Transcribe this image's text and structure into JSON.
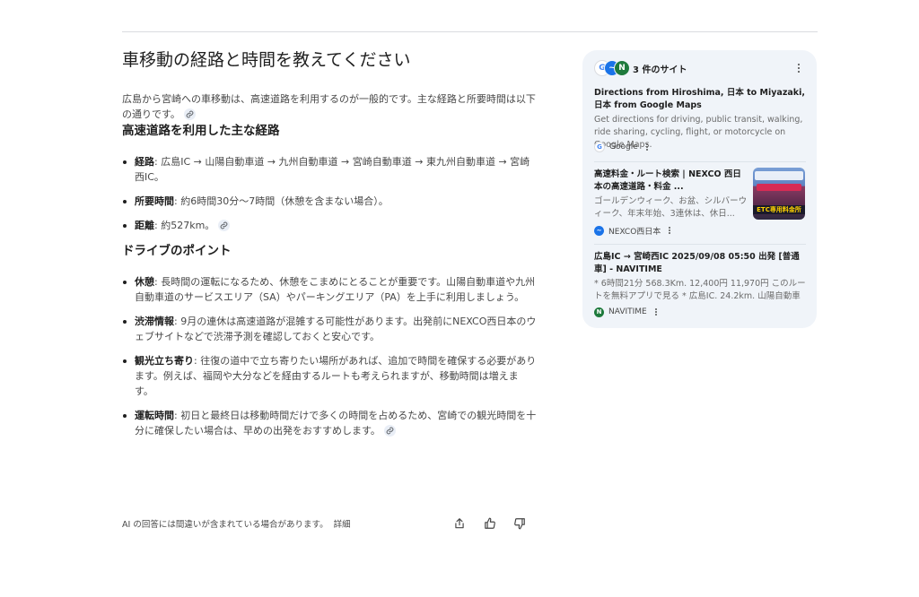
{
  "question": "車移動の経路と時間を教えてください",
  "intro": "広島から宮崎への車移動は、高速道路を利用するのが一般的です。主な経路と所要時間は以下の通りです。",
  "section1": {
    "heading": "高速道路を利用した主な経路",
    "items": [
      {
        "label": "経路",
        "text": ": 広島IC → 山陽自動車道 → 九州自動車道 → 宮崎自動車道 → 東九州自動車道 → 宮崎西IC。"
      },
      {
        "label": "所要時間",
        "text": ": 約6時間30分〜7時間（休憩を含まない場合）。"
      },
      {
        "label": "距離",
        "text": ": 約527km。"
      }
    ]
  },
  "section2": {
    "heading": "ドライブのポイント",
    "items": [
      {
        "label": "休憩",
        "text": ": 長時間の運転になるため、休憩をこまめにとることが重要です。山陽自動車道や九州自動車道のサービスエリア（SA）やパーキングエリア（PA）を上手に利用しましょう。"
      },
      {
        "label": "渋滞情報",
        "text": ": 9月の連休は高速道路が混雑する可能性があります。出発前にNEXCO西日本のウェブサイトなどで渋滞予測を確認しておくと安心です。"
      },
      {
        "label": "観光立ち寄り",
        "text": ": 往復の道中で立ち寄りたい場所があれば、追加で時間を確保する必要があります。例えば、福岡や大分などを経由するルートも考えられますが、移動時間は増えます。"
      },
      {
        "label": "運転時間",
        "text": ": 初日と最終日は移動時間だけで多くの時間を占めるため、宮崎での観光時間を十分に確保したい場合は、早めの出発をおすすめします。"
      }
    ]
  },
  "footer": {
    "disclaimer": "AI の回答には間違いが含まれている場合があります。",
    "more_link": "詳細"
  },
  "sources": {
    "count_label": "3 件のサイト",
    "items": [
      {
        "title": "Directions from Hiroshima, 日本 to Miyazaki, 日本 from Google Maps",
        "snippet": "Get directions for driving, public transit, walking, ride sharing, cycling, flight, or motorcycle on Google Maps.",
        "site": "Google",
        "icon": "google-icon"
      },
      {
        "title": "高速料金・ルート検索 | NEXCO 西日本の高速道路・料金 ...",
        "snippet": "ゴールデンウィーク、お盆、シルバーウィーク、年末年始、3連休は、休日...",
        "site": "NEXCO西日本",
        "icon": "nexco-icon",
        "thumb_text": "ETC専用料金所"
      },
      {
        "title": "広島IC → 宮崎西IC 2025/09/08 05:50 出発 [普通車] - NAVITIME",
        "snippet": "* 6時間21分 568.3Km. 12,400円 11,970円 このルートを無料アプリで見る * 広島IC. 24.2km. 山陽自動車道...",
        "site": "NAVITIME",
        "icon": "navitime-icon"
      }
    ]
  },
  "colors": {
    "panel_bg": "#f0f4f9",
    "text_primary": "#1f1f1f",
    "text_secondary": "#474747",
    "navitime_green": "#1e7a3c",
    "google_blue": "#4285f4"
  }
}
